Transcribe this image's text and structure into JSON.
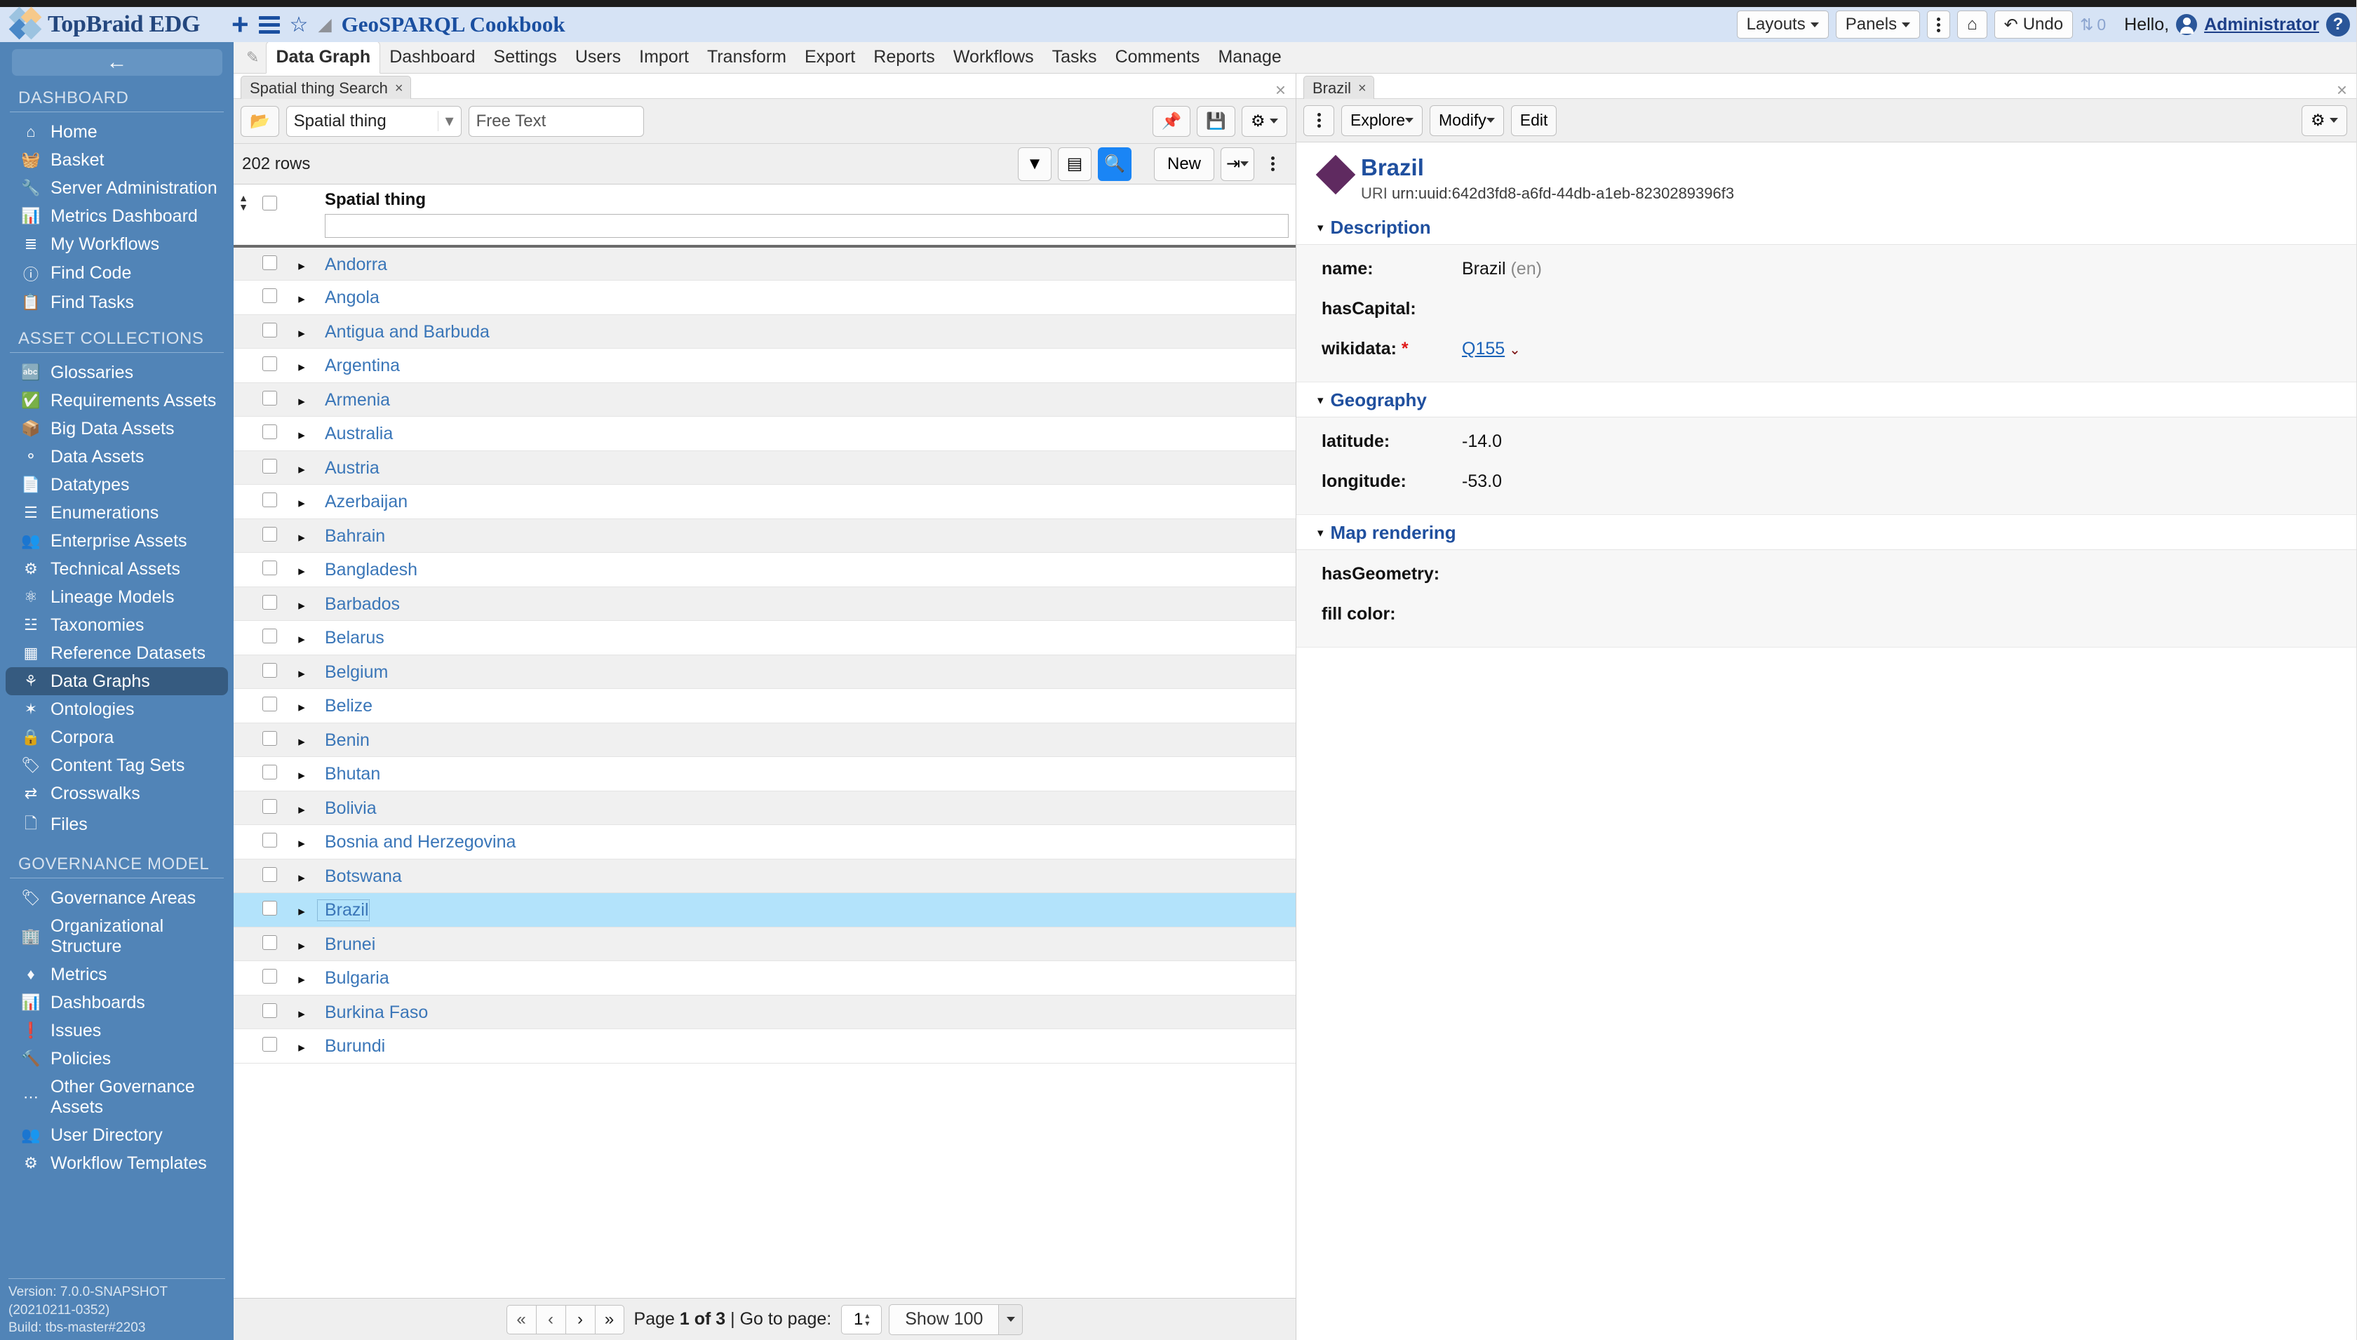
{
  "brand": {
    "name": "TopBraid EDG",
    "collection_title": "GeoSPARQL Cookbook",
    "plus_label": "+",
    "layouts_label": "Layouts",
    "panels_label": "Panels",
    "undo_label": "Undo",
    "sync_count": "0",
    "hello_label": "Hello,",
    "user_name": "Administrator",
    "help_label": "?"
  },
  "sidebar": {
    "collapse_label": "←",
    "sections": [
      {
        "title": "DASHBOARD",
        "items": [
          {
            "label": "Home",
            "icon": "home-icon",
            "glyph": "⌂"
          },
          {
            "label": "Basket",
            "icon": "basket-icon",
            "glyph": "🧺"
          },
          {
            "label": "Server Administration",
            "icon": "wrench-icon",
            "glyph": "🔧"
          },
          {
            "label": "Metrics Dashboard",
            "icon": "bar-chart-icon",
            "glyph": "📊"
          },
          {
            "label": "My Workflows",
            "icon": "task-list-icon",
            "glyph": "≣"
          },
          {
            "label": "Find Code",
            "icon": "info-circle-icon",
            "glyph": "ⓘ"
          },
          {
            "label": "Find Tasks",
            "icon": "clipboard-icon",
            "glyph": "📋"
          }
        ]
      },
      {
        "title": "ASSET COLLECTIONS",
        "items": [
          {
            "label": "Glossaries",
            "icon": "glossary-icon",
            "glyph": "🔤"
          },
          {
            "label": "Requirements Assets",
            "icon": "check-circle-icon",
            "glyph": "✅"
          },
          {
            "label": "Big Data Assets",
            "icon": "cube-icon",
            "glyph": "📦"
          },
          {
            "label": "Data Assets",
            "icon": "nodes-icon",
            "glyph": "⚬"
          },
          {
            "label": "Datatypes",
            "icon": "document-icon",
            "glyph": "📄"
          },
          {
            "label": "Enumerations",
            "icon": "list-icon",
            "glyph": "☰"
          },
          {
            "label": "Enterprise Assets",
            "icon": "people-icon",
            "glyph": "👥"
          },
          {
            "label": "Technical Assets",
            "icon": "gears-icon",
            "glyph": "⚙"
          },
          {
            "label": "Lineage Models",
            "icon": "atom-icon",
            "glyph": "⚛"
          },
          {
            "label": "Taxonomies",
            "icon": "hierarchy-icon",
            "glyph": "☳"
          },
          {
            "label": "Reference Datasets",
            "icon": "table-icon",
            "glyph": "▦"
          },
          {
            "label": "Data Graphs",
            "icon": "share-nodes-icon",
            "glyph": "⚘",
            "active": true
          },
          {
            "label": "Ontologies",
            "icon": "ontology-icon",
            "glyph": "✶"
          },
          {
            "label": "Corpora",
            "icon": "book-lock-icon",
            "glyph": "🔒"
          },
          {
            "label": "Content Tag Sets",
            "icon": "tag-icon",
            "glyph": "🏷"
          },
          {
            "label": "Crosswalks",
            "icon": "shuffle-icon",
            "glyph": "⇄"
          },
          {
            "label": "Files",
            "icon": "file-icon",
            "glyph": "🗋"
          }
        ]
      },
      {
        "title": "GOVERNANCE MODEL",
        "items": [
          {
            "label": "Governance Areas",
            "icon": "tags-icon",
            "glyph": "🏷"
          },
          {
            "label": "Organizational Structure",
            "icon": "building-icon",
            "glyph": "🏢"
          },
          {
            "label": "Metrics",
            "icon": "gem-icon",
            "glyph": "♦"
          },
          {
            "label": "Dashboards",
            "icon": "bar-chart-icon",
            "glyph": "📊"
          },
          {
            "label": "Issues",
            "icon": "exclamation-circle-icon",
            "glyph": "❗"
          },
          {
            "label": "Policies",
            "icon": "gavel-icon",
            "glyph": "🔨"
          },
          {
            "label": "Other Governance Assets",
            "icon": "ellipsis-icon",
            "glyph": "⋯"
          },
          {
            "label": "User Directory",
            "icon": "users-icon",
            "glyph": "👥"
          },
          {
            "label": "Workflow Templates",
            "icon": "gear-icon",
            "glyph": "⚙"
          }
        ]
      }
    ],
    "version_line": "Version: 7.0.0-SNAPSHOT (20210211-0352)",
    "build_line": "Build: tbs-master#2203"
  },
  "nav_tabs": [
    {
      "label": "Data Graph",
      "active": true
    },
    {
      "label": "Dashboard"
    },
    {
      "label": "Settings"
    },
    {
      "label": "Users"
    },
    {
      "label": "Import"
    },
    {
      "label": "Transform"
    },
    {
      "label": "Export"
    },
    {
      "label": "Reports"
    },
    {
      "label": "Workflows"
    },
    {
      "label": "Tasks"
    },
    {
      "label": "Comments"
    },
    {
      "label": "Manage"
    }
  ],
  "left_pane": {
    "tab_label": "Spatial thing Search",
    "tab_close": "×",
    "pane_close": "×",
    "search": {
      "folder_icon": "folder-open-icon",
      "class_value": "Spatial thing",
      "freetext_placeholder": "Free Text",
      "pin_icon": "pin-icon",
      "save_icon": "save-icon",
      "gear_icon": "gear-icon"
    },
    "rows_label": "202 rows",
    "toolbar": {
      "filter_icon": "funnel-icon",
      "columns_icon": "columns-icon",
      "search_icon": "magnifier-icon",
      "new_label": "New",
      "export_icon": "export-icon",
      "more_icon": "kebab-icon"
    },
    "table": {
      "column_header": "Spatial thing",
      "filter_value": "",
      "rows": [
        {
          "name": "Andorra"
        },
        {
          "name": "Angola"
        },
        {
          "name": "Antigua and Barbuda"
        },
        {
          "name": "Argentina"
        },
        {
          "name": "Armenia"
        },
        {
          "name": "Australia"
        },
        {
          "name": "Austria"
        },
        {
          "name": "Azerbaijan"
        },
        {
          "name": "Bahrain"
        },
        {
          "name": "Bangladesh"
        },
        {
          "name": "Barbados"
        },
        {
          "name": "Belarus"
        },
        {
          "name": "Belgium"
        },
        {
          "name": "Belize"
        },
        {
          "name": "Benin"
        },
        {
          "name": "Bhutan"
        },
        {
          "name": "Bolivia"
        },
        {
          "name": "Bosnia and Herzegovina"
        },
        {
          "name": "Botswana"
        },
        {
          "name": "Brazil",
          "selected": true
        },
        {
          "name": "Brunei"
        },
        {
          "name": "Bulgaria"
        },
        {
          "name": "Burkina Faso"
        },
        {
          "name": "Burundi"
        }
      ]
    },
    "pager": {
      "first": "«",
      "prev": "‹",
      "next": "›",
      "last": "»",
      "page_text_prefix": "Page",
      "page_current": "1 of 3",
      "goto_label": "| Go to page:",
      "goto_value": "1",
      "show_label": "Show 100"
    }
  },
  "right_pane": {
    "tab_label": "Brazil",
    "tab_close": "×",
    "pane_close": "×",
    "toolbar": {
      "more_icon": "kebab-icon",
      "explore_label": "Explore",
      "modify_label": "Modify",
      "edit_label": "Edit",
      "gear_icon": "gear-icon"
    },
    "resource": {
      "title": "Brazil",
      "uri_label": "URI",
      "uri_value": "urn:uuid:642d3fd8-a6fd-44db-a1eb-8230289396f3"
    },
    "sections": [
      {
        "title": "Description",
        "properties": [
          {
            "label": "name:",
            "value": "Brazil",
            "lang": "(en)",
            "required": false
          },
          {
            "label": "hasCapital:",
            "value": "",
            "required": false
          },
          {
            "label": "wikidata:",
            "value": "Q155",
            "required": true,
            "is_link": true,
            "has_caret": true
          }
        ]
      },
      {
        "title": "Geography",
        "properties": [
          {
            "label": "latitude:",
            "value": "-14.0",
            "required": false
          },
          {
            "label": "longitude:",
            "value": "-53.0",
            "required": false
          }
        ]
      },
      {
        "title": "Map rendering",
        "properties": [
          {
            "label": "hasGeometry:",
            "value": "",
            "required": false
          },
          {
            "label": "fill color:",
            "value": "",
            "required": false
          }
        ]
      }
    ]
  },
  "colors": {
    "brand_blue": "#1a4fa0",
    "sidebar_bg": "#5184b7",
    "sidebar_active": "#365b80",
    "accent_blue": "#1a85f5",
    "selection_row": "#b3e3fb",
    "link_blue": "#3a76b8",
    "diamond_purple": "#5f2a60",
    "required_red": "#e01b1b"
  }
}
